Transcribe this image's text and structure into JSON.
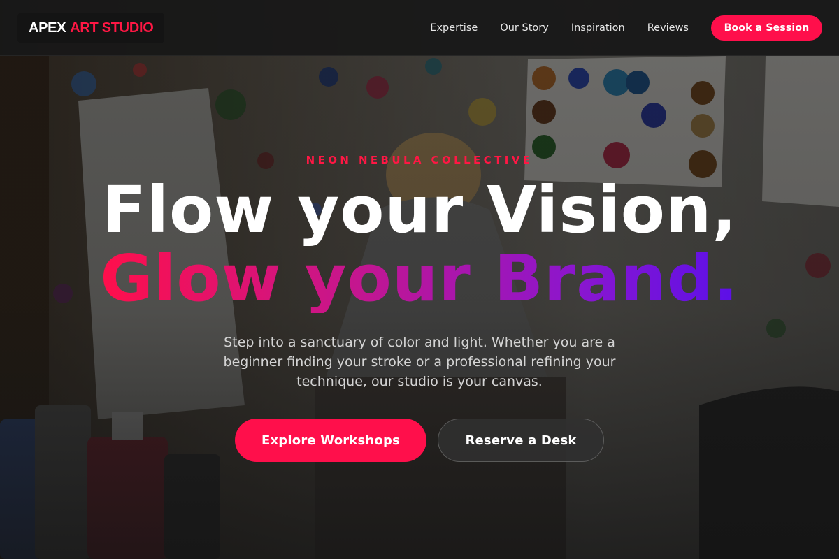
{
  "brand": {
    "name_part1": "APEX",
    "name_part2": "ART STUDIO",
    "accent": "#ff0f4b"
  },
  "nav": {
    "links": [
      "Expertise",
      "Our Story",
      "Inspiration",
      "Reviews"
    ],
    "cta_label": "Book a Session"
  },
  "hero": {
    "eyebrow": "NEON NEBULA COLLECTIVE",
    "headline_line1": "Flow your Vision,",
    "headline_line2": "Glow your Brand.",
    "subtitle": "Step into a sanctuary of color and light. Whether you are a beginner finding your stroke or a professional refining your technique, our studio is your canvas.",
    "primary_button": "Explore Workshops",
    "secondary_button": "Reserve a Desk",
    "gradient": [
      "#ff0f4b",
      "#c4168f",
      "#8a16cf",
      "#5b10e8"
    ],
    "background_image": "painting-studio-photo"
  }
}
